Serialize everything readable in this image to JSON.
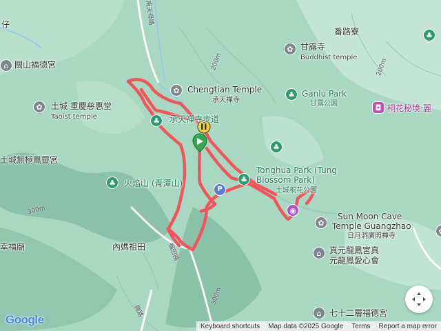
{
  "map": {
    "attribution": {
      "keyboard": "Keyboard shortcuts",
      "data": "Map data ©2025 Google",
      "terms": "Terms",
      "report": "Report a map error"
    },
    "logo": "Google",
    "colors": {
      "route": "#f2545b",
      "terrain": "#a9d8c2",
      "start_marker": "#35a853",
      "end_marker": "#f4d23b"
    },
    "labels": {
      "l_zai": "仔",
      "road_nantian": "南天母路",
      "fanlu": "番路寮",
      "ganlu_temple_zh": "甘露寺",
      "ganlu_temple_en": "Buddhist temple",
      "guanshan": "關山福德宮",
      "chengtian_en": "Chengtian Temple",
      "chengtian_zh": "承天禪寺",
      "ganlu_park_en": "Ganlu Park",
      "ganlu_park_zh": "甘露公園",
      "tucheng_temple_zh": "土城 重慶慈惠堂",
      "tucheng_temple_en": "Taoist temple",
      "tonghua_secret": "桐花秘境‧麗",
      "chengtian_trail": "承天禪寺步道",
      "wuji": "土城無極鳳靈宮",
      "huoyan": "火焰山 (青潭山)",
      "tonghua_en1": "Tonghua Park (Tung",
      "tonghua_en2": "Blossom Park)",
      "tonghua_zh": "土城桐花公園",
      "sunmoon_en1": "Sun Moon Cave",
      "sunmoon_en2": "Temple Guangzhao",
      "sunmoon_zh": "日月洞廣照禪寺",
      "xingfu": "幸福廟",
      "neima": "內媽祖田",
      "zhenyuan1": "真元龍鳳宮真",
      "zhenyuan2": "元龍鳳愛心會",
      "qishier": "七十二層福德宮",
      "road_right": "福田路",
      "road_ad": "開路",
      "parking": "P"
    },
    "contours": [
      "200m",
      "200m",
      "300m",
      "300m"
    ],
    "icons": [
      "temple-icon",
      "tree-icon",
      "parking-icon",
      "pin-icon",
      "photo-icon",
      "recenter-icon"
    ]
  }
}
